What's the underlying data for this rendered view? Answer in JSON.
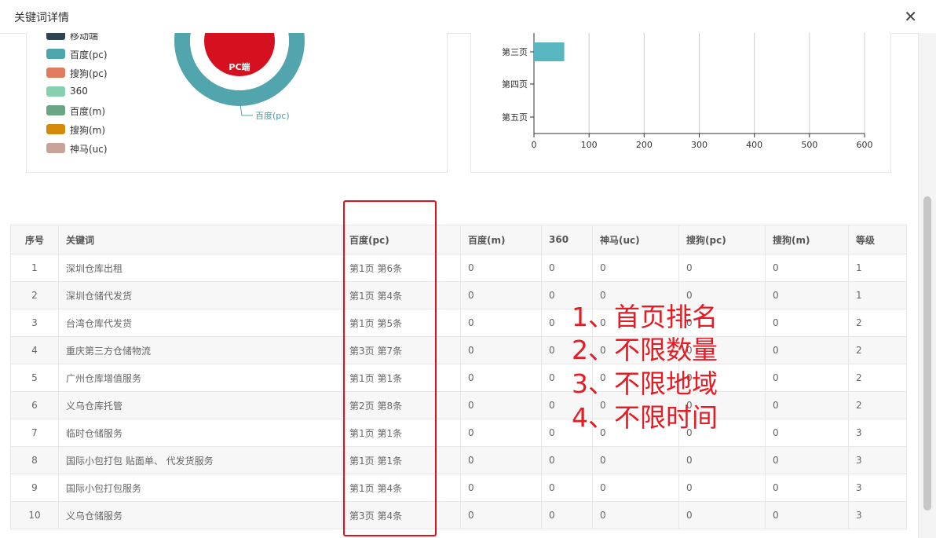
{
  "dialog": {
    "title": "关键词详情"
  },
  "legend": [
    {
      "label": "移动端",
      "color": "#2f4554"
    },
    {
      "label": "百度(pc)",
      "color": "#4ea6ac"
    },
    {
      "label": "搜狗(pc)",
      "color": "#e07b5d"
    },
    {
      "label": "360",
      "color": "#86cfb0"
    },
    {
      "label": "百度(m)",
      "color": "#6ba583"
    },
    {
      "label": "搜狗(m)",
      "color": "#d48b0a"
    },
    {
      "label": "神马(uc)",
      "color": "#c9a29a"
    }
  ],
  "pie": {
    "center_label": "PC端",
    "callout_label": "百度(pc)",
    "inner_color": "#d6111f",
    "ring_color": "#52a5ad"
  },
  "chart_data": {
    "type": "bar",
    "orientation": "horizontal",
    "categories": [
      "第三页",
      "第四页",
      "第五页"
    ],
    "values": [
      55,
      0,
      0
    ],
    "xlim": [
      0,
      600
    ],
    "xticks": [
      "0",
      "100",
      "200",
      "300",
      "400",
      "500",
      "600"
    ],
    "bar_color": "#58b6c0",
    "grid": true
  },
  "table": {
    "headers": [
      "序号",
      "关键词",
      "百度(pc)",
      "百度(m)",
      "360",
      "神马(uc)",
      "搜狗(pc)",
      "搜狗(m)",
      "等级"
    ],
    "rows": [
      [
        "1",
        "深圳仓库出租",
        "第1页 第6条",
        "0",
        "0",
        "0",
        "0",
        "0",
        "1"
      ],
      [
        "2",
        "深圳仓储代发货",
        "第1页 第4条",
        "0",
        "0",
        "0",
        "0",
        "0",
        "1"
      ],
      [
        "3",
        "台湾仓库代发货",
        "第1页 第5条",
        "0",
        "0",
        "0",
        "0",
        "0",
        "2"
      ],
      [
        "4",
        "重庆第三方仓储物流",
        "第3页 第7条",
        "0",
        "0",
        "0",
        "0",
        "0",
        "2"
      ],
      [
        "5",
        "广州仓库增值服务",
        "第1页 第1条",
        "0",
        "0",
        "0",
        "0",
        "0",
        "2"
      ],
      [
        "6",
        "义乌仓库托管",
        "第2页 第8条",
        "0",
        "0",
        "0",
        "0",
        "0",
        "2"
      ],
      [
        "7",
        "临时仓储服务",
        "第1页 第1条",
        "0",
        "0",
        "0",
        "0",
        "0",
        "3"
      ],
      [
        "8",
        "国际小包打包 贴面单、 代发货服务",
        "第1页 第1条",
        "0",
        "0",
        "0",
        "0",
        "0",
        "3"
      ],
      [
        "9",
        "国际小包打包服务",
        "第1页 第4条",
        "0",
        "0",
        "0",
        "0",
        "0",
        "3"
      ],
      [
        "10",
        "义乌仓储服务",
        "第3页 第4条",
        "0",
        "0",
        "0",
        "0",
        "0",
        "3"
      ]
    ]
  },
  "annotations": [
    "1、首页排名",
    "2、不限数量",
    "3、不限地域",
    "4、不限时间"
  ]
}
